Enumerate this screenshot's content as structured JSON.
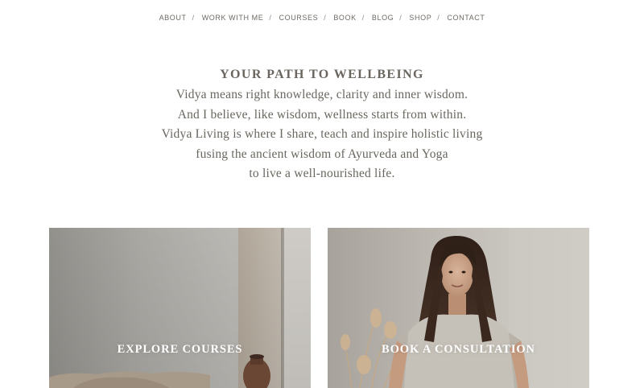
{
  "nav": {
    "items": [
      {
        "label": "ABOUT"
      },
      {
        "label": "WORK WITH ME"
      },
      {
        "label": "COURSES"
      },
      {
        "label": "BOOK"
      },
      {
        "label": "BLOG"
      },
      {
        "label": "SHOP"
      },
      {
        "label": "CONTACT"
      }
    ],
    "separator": "/"
  },
  "intro": {
    "title": "YOUR PATH TO WELLBEING",
    "lines": [
      "Vidya means right knowledge, clarity and inner wisdom.",
      "And I believe, like wisdom, wellness starts from within.",
      "Vidya Living is where I share, teach and inspire holistic living",
      "fusing the ancient wisdom of Ayurveda and Yoga",
      "to live a well-nourished life."
    ]
  },
  "cards": {
    "left": {
      "label": "EXPLORE COURSES"
    },
    "right": {
      "label": "BOOK A CONSULTATION"
    }
  },
  "colors": {
    "text": "#6a665f",
    "nav_text": "#6e6a63",
    "card_label": "#ffffff"
  }
}
